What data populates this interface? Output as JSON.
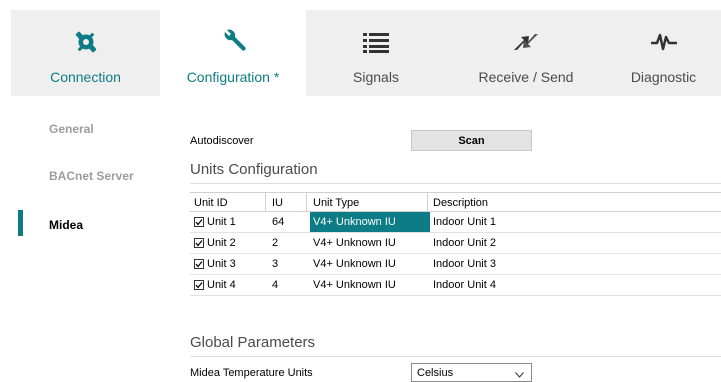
{
  "tabs": [
    {
      "label": "Connection",
      "icon": "plug-icon",
      "active": false
    },
    {
      "label": "Configuration *",
      "icon": "wrench-icon",
      "active": true
    },
    {
      "label": "Signals",
      "icon": "list-icon",
      "active": false
    },
    {
      "label": "Receive / Send",
      "icon": "transfer-arrows-icon",
      "active": false
    },
    {
      "label": "Diagnostic",
      "icon": "pulse-icon",
      "active": false
    }
  ],
  "sidebar": {
    "items": [
      {
        "label": "General",
        "active": false
      },
      {
        "label": "BACnet Server",
        "active": false
      },
      {
        "label": "Midea",
        "active": true
      }
    ]
  },
  "autodiscover": {
    "label": "Autodiscover",
    "button_label": "Scan"
  },
  "units_section": {
    "title": "Units Configuration",
    "columns": [
      "Unit ID",
      "IU",
      "Unit Type",
      "Description"
    ],
    "rows": [
      {
        "unit_id": "Unit 1",
        "iu": "64",
        "unit_type": "V4+ Unknown IU",
        "description": "Indoor Unit 1",
        "checked": true,
        "selected_type": true
      },
      {
        "unit_id": "Unit 2",
        "iu": "2",
        "unit_type": "V4+ Unknown IU",
        "description": "Indoor Unit 2",
        "checked": true,
        "selected_type": false
      },
      {
        "unit_id": "Unit 3",
        "iu": "3",
        "unit_type": "V4+ Unknown IU",
        "description": "Indoor Unit 3",
        "checked": true,
        "selected_type": false
      },
      {
        "unit_id": "Unit 4",
        "iu": "4",
        "unit_type": "V4+ Unknown IU",
        "description": "Indoor Unit 4",
        "checked": true,
        "selected_type": false
      }
    ]
  },
  "global_section": {
    "title": "Global Parameters",
    "temp_units_label": "Midea Temperature Units",
    "temp_units_value": "Celsius"
  },
  "colors": {
    "accent": "#0e7c86",
    "tab_bar": "#efefef",
    "sidebar_inactive": "#9c9c9c"
  }
}
